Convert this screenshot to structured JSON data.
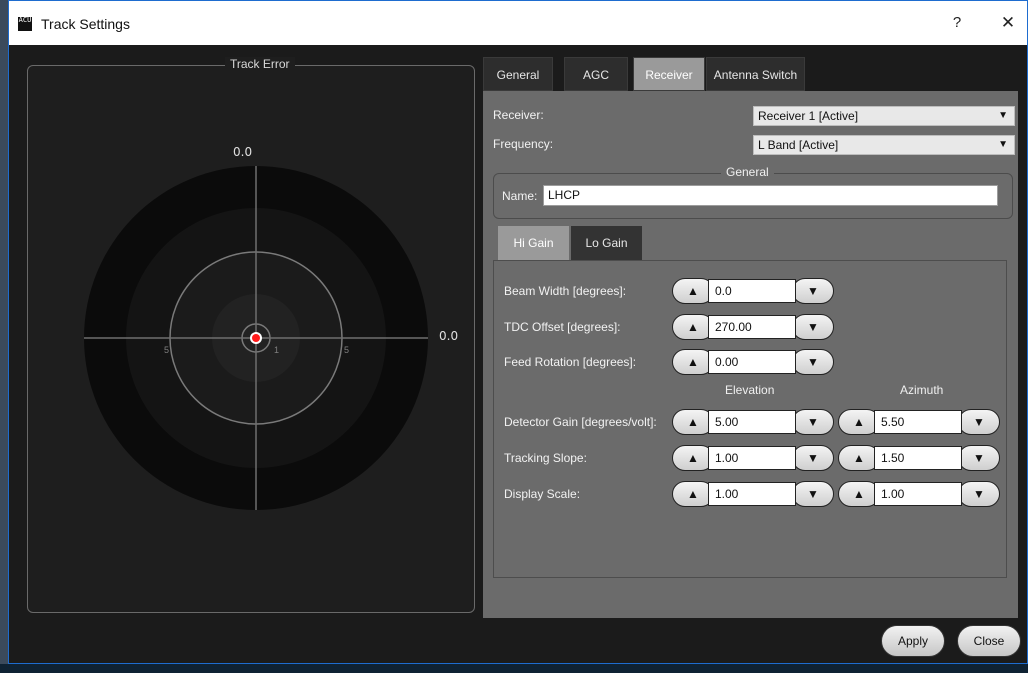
{
  "window": {
    "title": "Track Settings",
    "app_icon_text": "ACU",
    "help_label": "?",
    "close_label": "✕"
  },
  "track_error": {
    "label": "Track Error",
    "top_value": "0.0",
    "right_value": "0.0",
    "ring_labels": [
      "5",
      "1",
      "5"
    ]
  },
  "tabs": [
    "General",
    "AGC",
    "Receiver",
    "Antenna Switch"
  ],
  "active_tab": "Receiver",
  "receiver": {
    "receiver_label": "Receiver:",
    "receiver_value": "Receiver 1 [Active]",
    "frequency_label": "Frequency:",
    "frequency_value": "L Band [Active]",
    "general_group_title": "General",
    "name_label": "Name:",
    "name_value": "LHCP"
  },
  "gain_tabs": [
    "Hi Gain",
    "Lo Gain"
  ],
  "active_gain_tab": "Hi Gain",
  "hi_gain": {
    "beam_width_label": "Beam Width [degrees]:",
    "beam_width_value": "0.0",
    "tdc_offset_label": "TDC Offset [degrees]:",
    "tdc_offset_value": "270.00",
    "feed_rotation_label": "Feed Rotation [degrees]:",
    "feed_rotation_value": "0.00",
    "elevation_header": "Elevation",
    "azimuth_header": "Azimuth",
    "detector_gain_label": "Detector Gain [degrees/volt]:",
    "detector_gain_el": "5.00",
    "detector_gain_az": "5.50",
    "tracking_slope_label": "Tracking Slope:",
    "tracking_slope_el": "1.00",
    "tracking_slope_az": "1.50",
    "display_scale_label": "Display Scale:",
    "display_scale_el": "1.00",
    "display_scale_az": "1.00"
  },
  "spin_icons": {
    "up": "▲",
    "down": "▼"
  },
  "dropdown_arrow": "▼",
  "footer": {
    "apply_label": "Apply",
    "close_label": "Close"
  },
  "colors": {
    "accent_border": "#1e6ccf",
    "target_dot": "#ff1a1a"
  }
}
